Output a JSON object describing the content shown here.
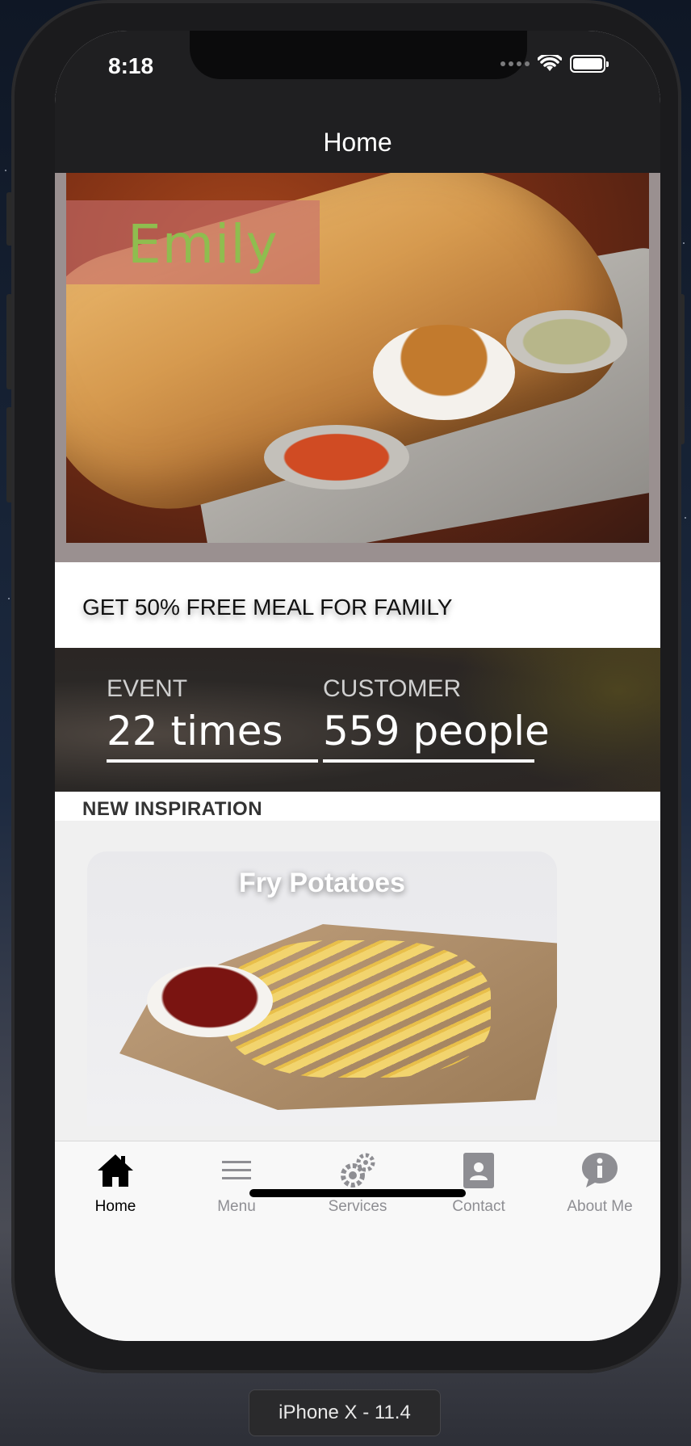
{
  "status_bar": {
    "time": "8:18"
  },
  "nav": {
    "title": "Home"
  },
  "hero": {
    "overlay_name": "Emily"
  },
  "promo": {
    "text": "GET 50% FREE MEAL FOR FAMILY"
  },
  "stats": [
    {
      "label": "EVENT",
      "value": "22 times"
    },
    {
      "label": "CUSTOMER",
      "value": "559 people"
    }
  ],
  "inspiration": {
    "section_label": "NEW INSPIRATION",
    "cards": [
      {
        "title": "Fry Potatoes"
      }
    ]
  },
  "tab_bar": {
    "items": [
      {
        "label": "Home",
        "icon": "home-icon",
        "active": true
      },
      {
        "label": "Menu",
        "icon": "menu-icon",
        "active": false
      },
      {
        "label": "Services",
        "icon": "gear-icon",
        "active": false
      },
      {
        "label": "Contact",
        "icon": "contact-icon",
        "active": false
      },
      {
        "label": "About Me",
        "icon": "info-icon",
        "active": false
      }
    ]
  },
  "device": {
    "label": "iPhone X - 11.4"
  },
  "colors": {
    "nav_background": "#1f1f21",
    "emily_text": "#8fbd4f",
    "emily_box": "#c86e6e",
    "tab_active": "#000000",
    "tab_inactive": "#8e8e93"
  }
}
